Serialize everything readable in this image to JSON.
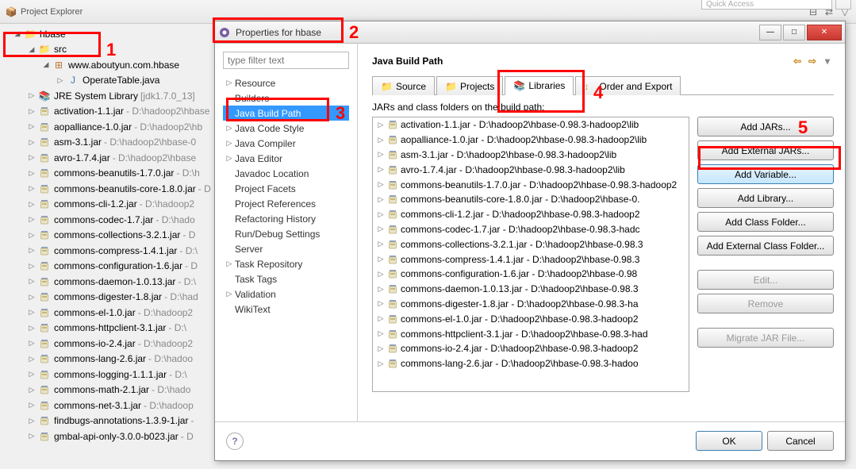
{
  "quick_access": "Quick Access",
  "explorer": {
    "title": "Project Explorer"
  },
  "project": {
    "name": "hbase",
    "src": "src",
    "package": "www.aboutyun.com.hbase",
    "javafile": "OperateTable.java",
    "jre": "JRE System Library",
    "jre_ver": "[jdk1.7.0_13]",
    "jars": [
      {
        "name": "activation-1.1.jar",
        "path": "D:\\hadoop2\\hbase"
      },
      {
        "name": "aopalliance-1.0.jar",
        "path": "D:\\hadoop2\\hb"
      },
      {
        "name": "asm-3.1.jar",
        "path": "D:\\hadoop2\\hbase-0"
      },
      {
        "name": "avro-1.7.4.jar",
        "path": "D:\\hadoop2\\hbase"
      },
      {
        "name": "commons-beanutils-1.7.0.jar",
        "path": "D:\\h"
      },
      {
        "name": "commons-beanutils-core-1.8.0.jar",
        "path": "D"
      },
      {
        "name": "commons-cli-1.2.jar",
        "path": "D:\\hadoop2"
      },
      {
        "name": "commons-codec-1.7.jar",
        "path": "D:\\hado"
      },
      {
        "name": "commons-collections-3.2.1.jar",
        "path": "D"
      },
      {
        "name": "commons-compress-1.4.1.jar",
        "path": "D:\\"
      },
      {
        "name": "commons-configuration-1.6.jar",
        "path": "D"
      },
      {
        "name": "commons-daemon-1.0.13.jar",
        "path": "D:\\"
      },
      {
        "name": "commons-digester-1.8.jar",
        "path": "D:\\had"
      },
      {
        "name": "commons-el-1.0.jar",
        "path": "D:\\hadoop2"
      },
      {
        "name": "commons-httpclient-3.1.jar",
        "path": "D:\\"
      },
      {
        "name": "commons-io-2.4.jar",
        "path": "D:\\hadoop2"
      },
      {
        "name": "commons-lang-2.6.jar",
        "path": "D:\\hadoo"
      },
      {
        "name": "commons-logging-1.1.1.jar",
        "path": "D:\\"
      },
      {
        "name": "commons-math-2.1.jar",
        "path": "D:\\hado"
      },
      {
        "name": "commons-net-3.1.jar",
        "path": "D:\\hadoop"
      },
      {
        "name": "findbugs-annotations-1.3.9-1.jar",
        "path": ""
      },
      {
        "name": "gmbal-api-only-3.0.0-b023.jar",
        "path": "D"
      }
    ]
  },
  "dialog": {
    "title": "Properties for hbase",
    "filter_placeholder": "type filter text",
    "categories": [
      "Resource",
      "Builders",
      "Java Build Path",
      "Java Code Style",
      "Java Compiler",
      "Java Editor",
      "Javadoc Location",
      "Project Facets",
      "Project References",
      "Refactoring History",
      "Run/Debug Settings",
      "Server",
      "Task Repository",
      "Task Tags",
      "Validation",
      "WikiText"
    ],
    "selected_category": "Java Build Path",
    "main_title": "Java Build Path",
    "tabs": [
      "Source",
      "Projects",
      "Libraries",
      "Order and Export"
    ],
    "active_tab": "Libraries",
    "sub_label": "JARs and class folders on the build path:",
    "jars": [
      "activation-1.1.jar - D:\\hadoop2\\hbase-0.98.3-hadoop2\\lib",
      "aopalliance-1.0.jar - D:\\hadoop2\\hbase-0.98.3-hadoop2\\lib",
      "asm-3.1.jar - D:\\hadoop2\\hbase-0.98.3-hadoop2\\lib",
      "avro-1.7.4.jar - D:\\hadoop2\\hbase-0.98.3-hadoop2\\lib",
      "commons-beanutils-1.7.0.jar - D:\\hadoop2\\hbase-0.98.3-hadoop2",
      "commons-beanutils-core-1.8.0.jar - D:\\hadoop2\\hbase-0.",
      "commons-cli-1.2.jar - D:\\hadoop2\\hbase-0.98.3-hadoop2",
      "commons-codec-1.7.jar - D:\\hadoop2\\hbase-0.98.3-hadc",
      "commons-collections-3.2.1.jar - D:\\hadoop2\\hbase-0.98.3",
      "commons-compress-1.4.1.jar - D:\\hadoop2\\hbase-0.98.3",
      "commons-configuration-1.6.jar - D:\\hadoop2\\hbase-0.98",
      "commons-daemon-1.0.13.jar - D:\\hadoop2\\hbase-0.98.3",
      "commons-digester-1.8.jar - D:\\hadoop2\\hbase-0.98.3-ha",
      "commons-el-1.0.jar - D:\\hadoop2\\hbase-0.98.3-hadoop2",
      "commons-httpclient-3.1.jar - D:\\hadoop2\\hbase-0.98.3-had",
      "commons-io-2.4.jar - D:\\hadoop2\\hbase-0.98.3-hadoop2",
      "commons-lang-2.6.jar - D:\\hadoop2\\hbase-0.98.3-hadoo"
    ],
    "buttons": {
      "add_jars": "Add JARs...",
      "add_external_jars": "Add External JARs...",
      "add_variable": "Add Variable...",
      "add_library": "Add Library...",
      "add_class_folder": "Add Class Folder...",
      "add_external_class_folder": "Add External Class Folder...",
      "edit": "Edit...",
      "remove": "Remove",
      "migrate": "Migrate JAR File..."
    },
    "ok": "OK",
    "cancel": "Cancel"
  },
  "annotations": {
    "one": "1",
    "two": "2",
    "three": "3",
    "four": "4",
    "five": "5"
  }
}
